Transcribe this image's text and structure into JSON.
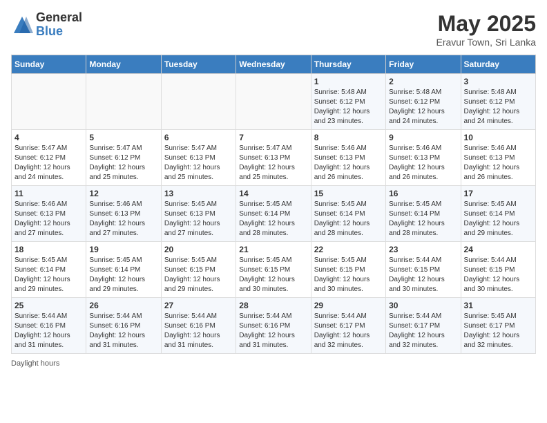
{
  "logo": {
    "general": "General",
    "blue": "Blue"
  },
  "title": "May 2025",
  "subtitle": "Eravur Town, Sri Lanka",
  "days_of_week": [
    "Sunday",
    "Monday",
    "Tuesday",
    "Wednesday",
    "Thursday",
    "Friday",
    "Saturday"
  ],
  "weeks": [
    [
      {
        "day": "",
        "info": ""
      },
      {
        "day": "",
        "info": ""
      },
      {
        "day": "",
        "info": ""
      },
      {
        "day": "",
        "info": ""
      },
      {
        "day": "1",
        "info": "Sunrise: 5:48 AM\nSunset: 6:12 PM\nDaylight: 12 hours\nand 23 minutes."
      },
      {
        "day": "2",
        "info": "Sunrise: 5:48 AM\nSunset: 6:12 PM\nDaylight: 12 hours\nand 24 minutes."
      },
      {
        "day": "3",
        "info": "Sunrise: 5:48 AM\nSunset: 6:12 PM\nDaylight: 12 hours\nand 24 minutes."
      }
    ],
    [
      {
        "day": "4",
        "info": "Sunrise: 5:47 AM\nSunset: 6:12 PM\nDaylight: 12 hours\nand 24 minutes."
      },
      {
        "day": "5",
        "info": "Sunrise: 5:47 AM\nSunset: 6:12 PM\nDaylight: 12 hours\nand 25 minutes."
      },
      {
        "day": "6",
        "info": "Sunrise: 5:47 AM\nSunset: 6:13 PM\nDaylight: 12 hours\nand 25 minutes."
      },
      {
        "day": "7",
        "info": "Sunrise: 5:47 AM\nSunset: 6:13 PM\nDaylight: 12 hours\nand 25 minutes."
      },
      {
        "day": "8",
        "info": "Sunrise: 5:46 AM\nSunset: 6:13 PM\nDaylight: 12 hours\nand 26 minutes."
      },
      {
        "day": "9",
        "info": "Sunrise: 5:46 AM\nSunset: 6:13 PM\nDaylight: 12 hours\nand 26 minutes."
      },
      {
        "day": "10",
        "info": "Sunrise: 5:46 AM\nSunset: 6:13 PM\nDaylight: 12 hours\nand 26 minutes."
      }
    ],
    [
      {
        "day": "11",
        "info": "Sunrise: 5:46 AM\nSunset: 6:13 PM\nDaylight: 12 hours\nand 27 minutes."
      },
      {
        "day": "12",
        "info": "Sunrise: 5:46 AM\nSunset: 6:13 PM\nDaylight: 12 hours\nand 27 minutes."
      },
      {
        "day": "13",
        "info": "Sunrise: 5:45 AM\nSunset: 6:13 PM\nDaylight: 12 hours\nand 27 minutes."
      },
      {
        "day": "14",
        "info": "Sunrise: 5:45 AM\nSunset: 6:14 PM\nDaylight: 12 hours\nand 28 minutes."
      },
      {
        "day": "15",
        "info": "Sunrise: 5:45 AM\nSunset: 6:14 PM\nDaylight: 12 hours\nand 28 minutes."
      },
      {
        "day": "16",
        "info": "Sunrise: 5:45 AM\nSunset: 6:14 PM\nDaylight: 12 hours\nand 28 minutes."
      },
      {
        "day": "17",
        "info": "Sunrise: 5:45 AM\nSunset: 6:14 PM\nDaylight: 12 hours\nand 29 minutes."
      }
    ],
    [
      {
        "day": "18",
        "info": "Sunrise: 5:45 AM\nSunset: 6:14 PM\nDaylight: 12 hours\nand 29 minutes."
      },
      {
        "day": "19",
        "info": "Sunrise: 5:45 AM\nSunset: 6:14 PM\nDaylight: 12 hours\nand 29 minutes."
      },
      {
        "day": "20",
        "info": "Sunrise: 5:45 AM\nSunset: 6:15 PM\nDaylight: 12 hours\nand 29 minutes."
      },
      {
        "day": "21",
        "info": "Sunrise: 5:45 AM\nSunset: 6:15 PM\nDaylight: 12 hours\nand 30 minutes."
      },
      {
        "day": "22",
        "info": "Sunrise: 5:45 AM\nSunset: 6:15 PM\nDaylight: 12 hours\nand 30 minutes."
      },
      {
        "day": "23",
        "info": "Sunrise: 5:44 AM\nSunset: 6:15 PM\nDaylight: 12 hours\nand 30 minutes."
      },
      {
        "day": "24",
        "info": "Sunrise: 5:44 AM\nSunset: 6:15 PM\nDaylight: 12 hours\nand 30 minutes."
      }
    ],
    [
      {
        "day": "25",
        "info": "Sunrise: 5:44 AM\nSunset: 6:16 PM\nDaylight: 12 hours\nand 31 minutes."
      },
      {
        "day": "26",
        "info": "Sunrise: 5:44 AM\nSunset: 6:16 PM\nDaylight: 12 hours\nand 31 minutes."
      },
      {
        "day": "27",
        "info": "Sunrise: 5:44 AM\nSunset: 6:16 PM\nDaylight: 12 hours\nand 31 minutes."
      },
      {
        "day": "28",
        "info": "Sunrise: 5:44 AM\nSunset: 6:16 PM\nDaylight: 12 hours\nand 31 minutes."
      },
      {
        "day": "29",
        "info": "Sunrise: 5:44 AM\nSunset: 6:17 PM\nDaylight: 12 hours\nand 32 minutes."
      },
      {
        "day": "30",
        "info": "Sunrise: 5:44 AM\nSunset: 6:17 PM\nDaylight: 12 hours\nand 32 minutes."
      },
      {
        "day": "31",
        "info": "Sunrise: 5:45 AM\nSunset: 6:17 PM\nDaylight: 12 hours\nand 32 minutes."
      }
    ]
  ],
  "footer": "Daylight hours"
}
